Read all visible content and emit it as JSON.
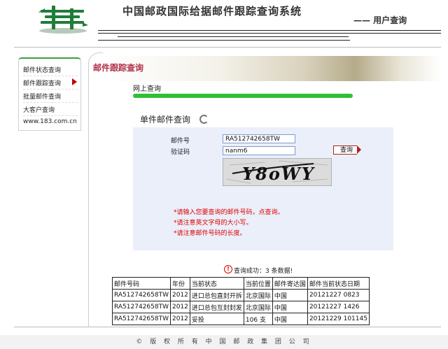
{
  "header": {
    "site_title": "中国邮政国际给据邮件跟踪查询系统",
    "user_query": "—— 用户查询",
    "logo_icon": "china-post-logo",
    "logo_color": "#1f7d3a"
  },
  "left_nav": {
    "items": [
      {
        "label": "邮件状态查询"
      },
      {
        "label": "邮件跟踪查询"
      },
      {
        "label": "批量邮件查询"
      },
      {
        "label": "大客户查询"
      },
      {
        "label": "www.183.com.cn"
      }
    ],
    "active_index": 1
  },
  "content": {
    "banner_title": "邮件跟踪查询",
    "online_query": "网上查询",
    "single_query_title": "单件邮件查询",
    "form": {
      "mail_no_label": "邮件号",
      "mail_no_value": "RA512742658TW",
      "captcha_label": "验证码",
      "captcha_value": "nanm6",
      "query_button": "查询",
      "captcha_text": "Y8oWY"
    },
    "notes": [
      "*请输入您要查询的邮件号码，点查询。",
      "*请注意英文字母的大小写。",
      "*请注意邮件号码的长度。"
    ],
    "result_message": "查询成功：3 条数据!"
  },
  "table": {
    "headers": [
      "邮件号码",
      "年份",
      "当前状态",
      "当前位置",
      "邮件寄达国",
      "邮件当前状态日期"
    ],
    "rows": [
      [
        "RA512742658TW",
        "2012",
        "进口总包直封开拆",
        "北京国际",
        "中国",
        "20121227 0823"
      ],
      [
        "RA512742658TW",
        "2012",
        "进口总包互封封发",
        "北京国际",
        "中国",
        "20121227 1426"
      ],
      [
        "RA512742658TW",
        "2012",
        "妥投",
        "106 支",
        "中国",
        "20121229 101145"
      ]
    ]
  },
  "footer": {
    "copyright": "© 版 权 所 有 中 国 邮 政 集 团 公 司"
  },
  "colors": {
    "accent_green": "#2fc035",
    "banner_title": "#b0304a",
    "note_red": "#e00000",
    "panel_bg": "#eaeffa"
  }
}
